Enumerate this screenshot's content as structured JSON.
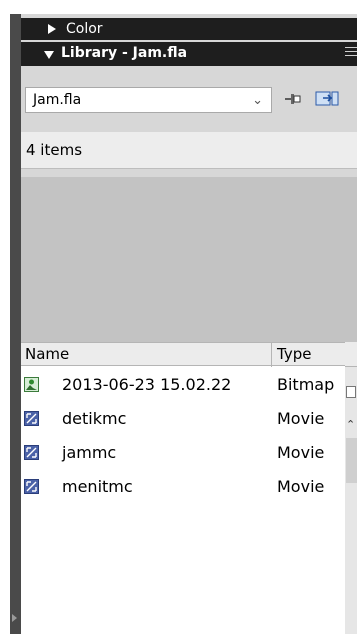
{
  "panels": {
    "color": {
      "title": "Color",
      "expanded": false
    },
    "library": {
      "title": "Library - Jam.fla",
      "expanded": true
    }
  },
  "toolbar": {
    "document_select": {
      "value": "Jam.fla"
    },
    "icons": [
      "pin-icon",
      "new-library-panel-icon"
    ]
  },
  "library": {
    "item_count": "4 items",
    "columns": {
      "name": "Name",
      "type": "Type"
    },
    "items": [
      {
        "name": "2013-06-23 15.02.22",
        "type": "Bitmap",
        "icon": "bitmap-icon"
      },
      {
        "name": "detikmc",
        "type": "Movie",
        "icon": "movieclip-icon"
      },
      {
        "name": "jammc",
        "type": "Movie",
        "icon": "movieclip-icon"
      },
      {
        "name": "menitmc",
        "type": "Movie",
        "icon": "movieclip-icon"
      }
    ]
  },
  "colors": {
    "panel_header": "#1e1e1e",
    "panel_bg": "#d7d7d7",
    "preview_bg": "#c3c3c3"
  }
}
